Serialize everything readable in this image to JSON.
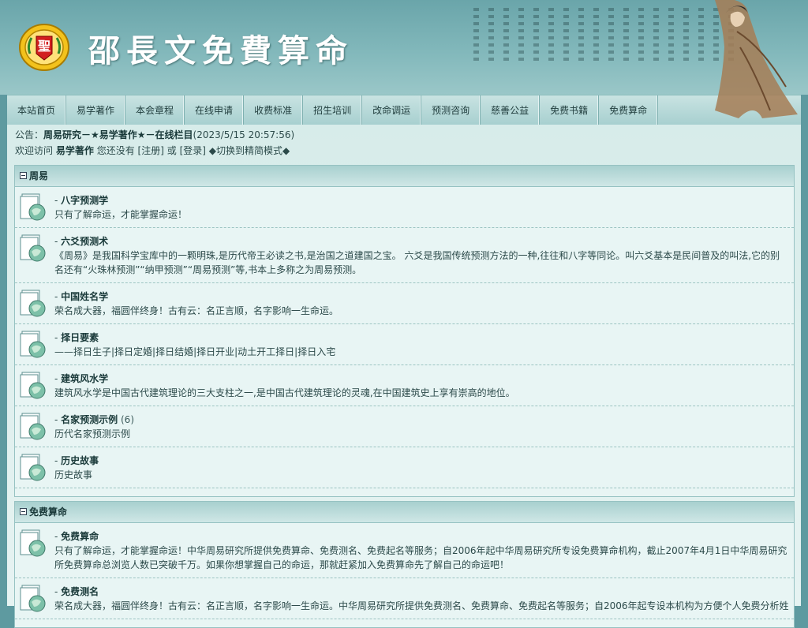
{
  "header": {
    "title": "邵長文免費算命",
    "logo_char": "聖"
  },
  "nav": [
    "本站首页",
    "易学著作",
    "本会章程",
    "在线申请",
    "收费标准",
    "招生培训",
    "改命调运",
    "预测咨询",
    "慈善公益",
    "免费书籍",
    "免费算命"
  ],
  "notice": {
    "label": "公告：",
    "text": "周易研究－★易学著作★－在线栏目",
    "time": "(2023/5/15 20:57:56)"
  },
  "welcome": {
    "prefix": "欢迎访问",
    "site": "易学著作",
    "mid": "您还没有",
    "register": "[注册]",
    "or": "或",
    "login": "[登录]",
    "switch": "◆切换到精简模式◆"
  },
  "sections": [
    {
      "title": "周易",
      "forums": [
        {
          "title": "八字预测学",
          "count": "",
          "desc": "只有了解命运，才能掌握命运！"
        },
        {
          "title": "六爻预测术",
          "count": "",
          "desc": "《周易》是我国科学宝库中的一颗明珠,是历代帝王必读之书,是治国之道建国之宝。 六爻是我国传统预测方法的一种,往往和八字等同论。叫六爻基本是民间普及的叫法,它的别名还有“火珠林预测”“纳甲预测”“周易预测”等,书本上多称之为周易预测。"
        },
        {
          "title": "中国姓名学",
          "count": "",
          "desc": "荣名成大器，福圆伴终身！古有云：名正言顺，名字影响一生命运。"
        },
        {
          "title": "择日要素",
          "count": "",
          "desc": "——择日生子|择日定婚|择日结婚|择日开业|动土开工择日|择日入宅"
        },
        {
          "title": "建筑风水学",
          "count": "",
          "desc": "建筑风水学是中国古代建筑理论的三大支柱之一,是中国古代建筑理论的灵魂,在中国建筑史上享有崇高的地位。"
        },
        {
          "title": "名家预测示例",
          "count": "(6)",
          "desc": "历代名家预测示例"
        },
        {
          "title": "历史故事",
          "count": "",
          "desc": "历史故事"
        }
      ]
    },
    {
      "title": "免费算命",
      "forums": [
        {
          "title": "免费算命",
          "count": "",
          "desc": "只有了解命运，才能掌握命运！中华周易研究所提供免费算命、免费测名、免费起名等服务；自2006年起中华周易研究所专设免费算命机构，截止2007年4月1日中华周易研究所免费算命总浏览人数已突破千万。如果你想掌握自己的命运，那就赶紧加入免费算命先了解自己的命运吧！"
        },
        {
          "title": "免费测名",
          "count": "",
          "desc": "荣名成大器，福圆伴终身！古有云：名正言顺，名字影响一生命运。中华周易研究所提供免费测名、免费算命、免费起名等服务；自2006年起专设本机构为方便个人免费分析姓"
        }
      ]
    }
  ]
}
